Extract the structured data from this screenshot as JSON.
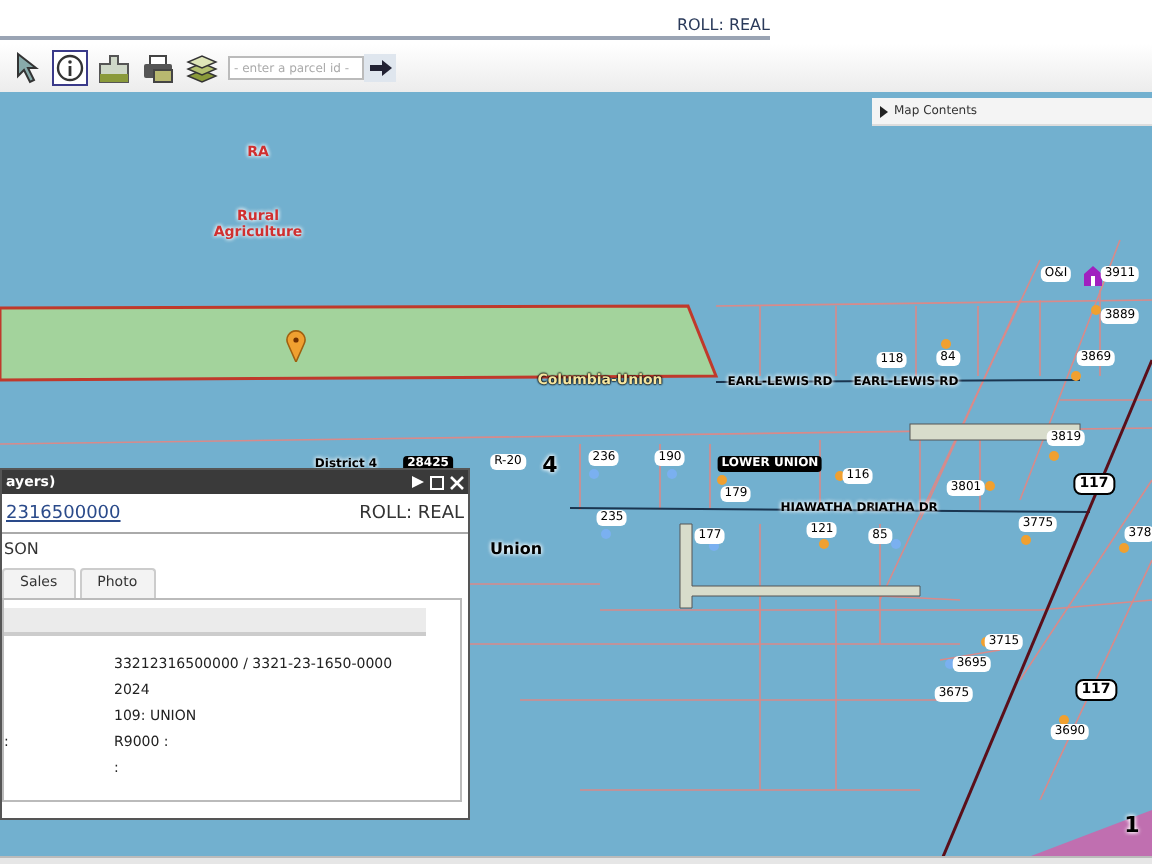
{
  "header": {
    "roll": "ROLL: REAL"
  },
  "toolbar": {
    "tools": [
      {
        "kind": "pointer",
        "selected": false
      },
      {
        "kind": "info",
        "selected": true
      },
      {
        "kind": "measure",
        "selected": false
      },
      {
        "kind": "print",
        "selected": false
      },
      {
        "kind": "layers",
        "selected": false
      }
    ],
    "search": {
      "placeholder": "- enter a parcel id -"
    }
  },
  "map_contents": {
    "label": "Map Contents"
  },
  "map_labels": [
    {
      "text": "RA",
      "kind": "zone"
    },
    {
      "text": "Rural Agriculture",
      "kind": "zone"
    },
    {
      "text": "Columbia-Union",
      "kind": "boundary"
    },
    {
      "text": "EARL-LEWIS RD",
      "kind": "road"
    },
    {
      "text": "EARL-LEWIS RD",
      "kind": "road"
    },
    {
      "text": "118",
      "kind": "address"
    },
    {
      "text": "84",
      "kind": "address"
    },
    {
      "text": "O&I",
      "kind": "address"
    },
    {
      "text": "3911",
      "kind": "address"
    },
    {
      "text": "3889",
      "kind": "address"
    },
    {
      "text": "3869",
      "kind": "address"
    },
    {
      "text": "3819",
      "kind": "address"
    },
    {
      "text": "District 4",
      "kind": "road"
    },
    {
      "text": "28425",
      "kind": "badge"
    },
    {
      "text": "R-20",
      "kind": "address"
    },
    {
      "text": "4",
      "kind": "district"
    },
    {
      "text": "236",
      "kind": "address"
    },
    {
      "text": "190",
      "kind": "address"
    },
    {
      "text": "LOWER UNION",
      "kind": "badge"
    },
    {
      "text": "116",
      "kind": "address"
    },
    {
      "text": "179",
      "kind": "address"
    },
    {
      "text": "3801",
      "kind": "address"
    },
    {
      "text": "HIAWATHA DR",
      "kind": "road"
    },
    {
      "text": "IATHA DR",
      "kind": "road"
    },
    {
      "text": "235",
      "kind": "address"
    },
    {
      "text": "177",
      "kind": "address"
    },
    {
      "text": "121",
      "kind": "address"
    },
    {
      "text": "85",
      "kind": "address"
    },
    {
      "text": "3775",
      "kind": "address"
    },
    {
      "text": "378",
      "kind": "address"
    },
    {
      "text": "Union",
      "kind": "place"
    },
    {
      "text": "117",
      "kind": "shield"
    },
    {
      "text": "3715",
      "kind": "address"
    },
    {
      "text": "3695",
      "kind": "address"
    },
    {
      "text": "3675",
      "kind": "address"
    },
    {
      "text": "117",
      "kind": "shield"
    },
    {
      "text": "3690",
      "kind": "address"
    },
    {
      "text": "1",
      "kind": "district"
    }
  ],
  "popup": {
    "title": "ayers)",
    "parcel": "2316500000",
    "roll": "ROLL: REAL",
    "owner": "SON",
    "tabs": [
      {
        "label": "Sales",
        "selected": false
      },
      {
        "label": "Photo",
        "selected": false
      }
    ],
    "rows": [
      {
        "value": "33212316500000 / 3321-23-1650-0000"
      },
      {
        "value": "2024"
      },
      {
        "value": "109: UNION"
      },
      {
        "label": ":",
        "value": "R9000 :"
      },
      {
        "value": ":"
      }
    ]
  }
}
